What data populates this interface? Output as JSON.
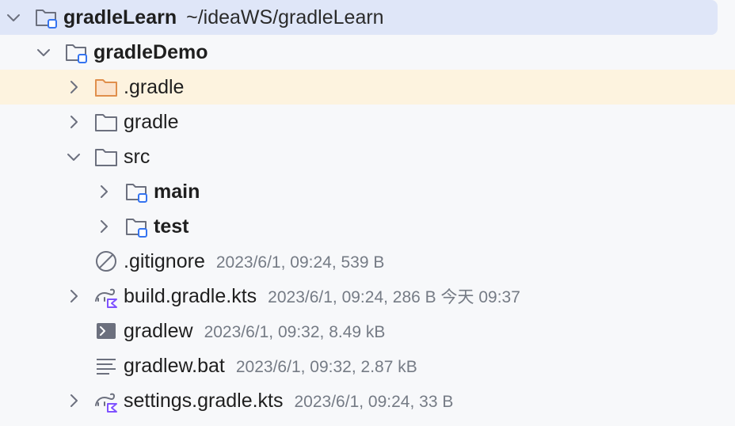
{
  "tree": {
    "root": {
      "name": "gradleLearn",
      "path": "~/ideaWS/gradleLearn"
    },
    "module": {
      "name": "gradleDemo"
    },
    "items": [
      {
        "name": ".gradle",
        "meta": ""
      },
      {
        "name": "gradle",
        "meta": ""
      },
      {
        "name": "src",
        "meta": ""
      },
      {
        "name": "main",
        "meta": ""
      },
      {
        "name": "test",
        "meta": ""
      },
      {
        "name": ".gitignore",
        "meta": "2023/6/1, 09:24, 539 B"
      },
      {
        "name": "build.gradle.kts",
        "meta": "2023/6/1, 09:24, 286 B 今天 09:37"
      },
      {
        "name": "gradlew",
        "meta": "2023/6/1, 09:32, 8.49 kB"
      },
      {
        "name": "gradlew.bat",
        "meta": "2023/6/1, 09:32, 2.87 kB"
      },
      {
        "name": "settings.gradle.kts",
        "meta": "2023/6/1, 09:24, 33 B"
      }
    ]
  },
  "colors": {
    "selected_row": "#dfe6f8",
    "highlight_row": "#fdf3df",
    "folder_orange": "#e08f4c",
    "module_blue": "#3574f0",
    "kotlin_purple": "#7f52ff"
  },
  "icons": [
    "chevron-down-icon",
    "chevron-right-icon",
    "module-folder-icon",
    "folder-icon",
    "excluded-folder-icon",
    "source-folder-icon",
    "ignore-file-icon",
    "gradle-kotlin-icon",
    "shell-script-icon",
    "text-file-icon"
  ]
}
